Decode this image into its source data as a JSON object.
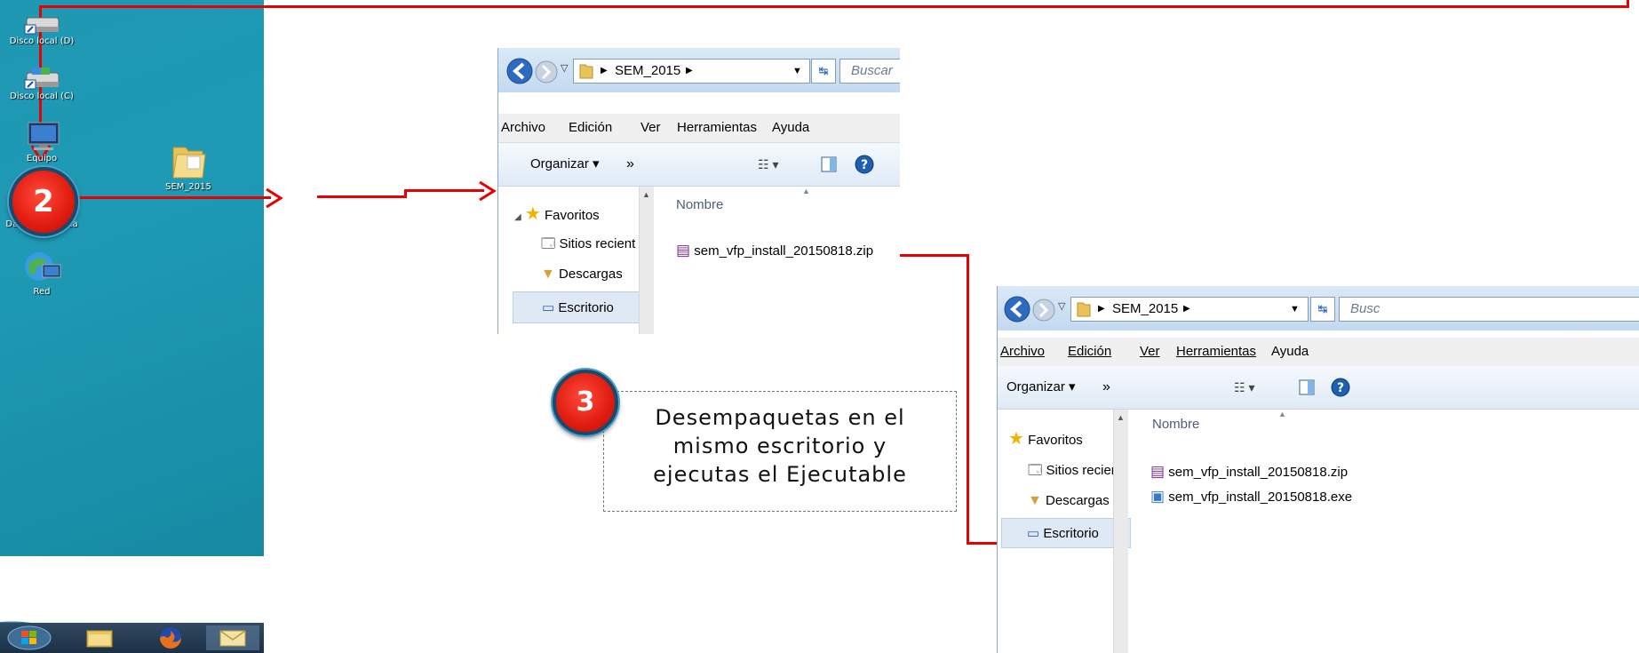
{
  "colors": {
    "arrow": "#e60000",
    "badge": "#e01b10",
    "desktop": "#1e9ab5"
  },
  "desktop": {
    "icons": [
      {
        "label": "Disco local (D)",
        "icon": "drive-icon"
      },
      {
        "label": "Disco local (C)",
        "icon": "drive-icon"
      },
      {
        "label": "Equipo",
        "icon": "computer-icon"
      },
      {
        "label": "Data Estadistica",
        "icon": "folder-shortcut-icon"
      },
      {
        "label": "Red",
        "icon": "network-icon"
      },
      {
        "label": "SEM_2015",
        "icon": "folder-icon"
      }
    ],
    "taskbar": [
      "start-button",
      "explorer-icon",
      "firefox-icon",
      "mail-icon"
    ]
  },
  "steps": {
    "step2": "2",
    "step3": "3",
    "callout": [
      "Desempaquetas en el",
      "mismo escritorio y",
      "ejecutas el Ejecutable"
    ]
  },
  "window1": {
    "path": "SEM_2015",
    "search_placeholder": "Buscar",
    "menu": [
      "Archivo",
      "Edición",
      "Ver",
      "Herramientas",
      "Ayuda"
    ],
    "organize": "Organizar ▾",
    "more": "»",
    "favorites": "Favoritos",
    "sidebar": [
      "Sitios recient",
      "Descargas",
      "Escritorio"
    ],
    "column": "Nombre",
    "files": [
      "sem_vfp_install_20150818.zip"
    ]
  },
  "window2": {
    "path": "SEM_2015",
    "search_placeholder": "Busc",
    "menu": [
      "Archivo",
      "Edición",
      "Ver",
      "Herramientas",
      "Ayuda"
    ],
    "organize": "Organizar ▾",
    "more": "»",
    "favorites": "Favoritos",
    "sidebar": [
      "Sitios recient",
      "Descargas",
      "Escritorio"
    ],
    "column": "Nombre",
    "files": [
      "sem_vfp_install_20150818.zip",
      "sem_vfp_install_20150818.exe"
    ]
  }
}
